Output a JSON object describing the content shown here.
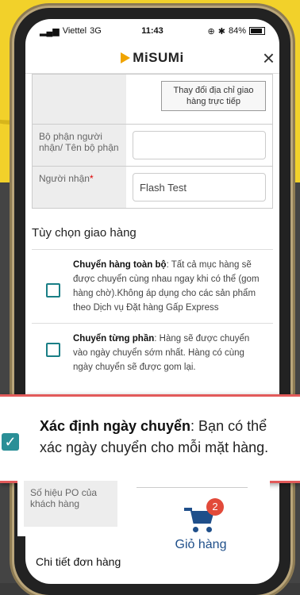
{
  "status_bar": {
    "carrier": "Viettel",
    "network": "3G",
    "time": "11:43",
    "battery": "84%"
  },
  "header": {
    "brand": "MiSUMi",
    "close_symbol": "×"
  },
  "address": {
    "change_button": "Thay đổi địa chỉ giao hàng trực tiếp"
  },
  "form": {
    "department_label": "Bộ phận người nhận/ Tên bộ phận",
    "department_value": "",
    "receiver_label": "Người nhận",
    "receiver_required": "*",
    "receiver_value": "Flash Test"
  },
  "shipping_options": {
    "title": "Tùy chọn giao hàng",
    "options": [
      {
        "bold": "Chuyển hàng toàn bộ",
        "text": ": Tất cả mục hàng sẽ được chuyển cùng nhau ngay khi có thể (gom hàng chờ).Không áp dụng cho các sản phẩm theo Dịch vụ Đặt hàng Gấp Express"
      },
      {
        "bold": "Chuyển từng phần",
        "text": ": Hàng sẽ được chuyển vào ngày chuyển sớm nhất. Hàng có cùng ngày chuyển sẽ được gom lại."
      }
    ],
    "highlight": {
      "bold": "Xác định ngày chuyển",
      "text": ": Bạn có thể xác ngày chuyển cho mỗi mặt hàng."
    }
  },
  "po": {
    "label": "Số hiệu PO của khách hàng"
  },
  "cart": {
    "label": "Giỏ hàng",
    "count": "2"
  },
  "order_details": {
    "title": "Chi tiết đơn hàng"
  },
  "colors": {
    "accent": "#1a7f86",
    "brand_blue": "#1f4f8a",
    "badge": "#e24a3a",
    "highlight_border": "#e25a5a"
  }
}
